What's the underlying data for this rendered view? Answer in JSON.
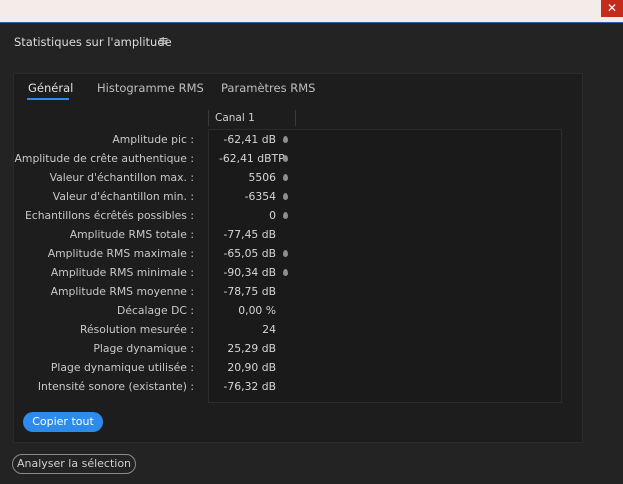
{
  "window": {
    "close_glyph": "✕"
  },
  "panel": {
    "title": "Statistiques sur l'amplitude",
    "menu_icon": "menu-icon"
  },
  "tabs": [
    {
      "label": "Général",
      "active": true
    },
    {
      "label": "Histogramme RMS",
      "active": false
    },
    {
      "label": "Paramètres RMS",
      "active": false
    }
  ],
  "table": {
    "column_header": "Canal 1",
    "rows": [
      {
        "label": "Amplitude pic :",
        "value": "-62,41 dB",
        "pin": true
      },
      {
        "label": "Amplitude de crête authentique :",
        "value": "-62,41 dBTP",
        "pin": true
      },
      {
        "label": "Valeur d'échantillon max. :",
        "value": "5506",
        "pin": true
      },
      {
        "label": "Valeur d'échantillon min. :",
        "value": "-6354",
        "pin": true
      },
      {
        "label": "Echantillons écrêtés possibles :",
        "value": "0",
        "pin": true
      },
      {
        "label": "Amplitude RMS totale :",
        "value": "-77,45 dB",
        "pin": false
      },
      {
        "label": "Amplitude RMS maximale :",
        "value": "-65,05 dB",
        "pin": true
      },
      {
        "label": "Amplitude RMS minimale :",
        "value": "-90,34 dB",
        "pin": true
      },
      {
        "label": "Amplitude RMS moyenne :",
        "value": "-78,75 dB",
        "pin": false
      },
      {
        "label": "Décalage DC :",
        "value": "0,00 %",
        "pin": false
      },
      {
        "label": "Résolution mesurée :",
        "value": "24",
        "pin": false
      },
      {
        "label": "Plage dynamique :",
        "value": "25,29 dB",
        "pin": false
      },
      {
        "label": "Plage dynamique utilisée :",
        "value": "20,90 dB",
        "pin": false
      },
      {
        "label": "Intensité sonore (existante) :",
        "value": "-76,32 dB",
        "pin": false
      }
    ]
  },
  "buttons": {
    "copy_all": "Copier tout",
    "analyze_selection": "Analyser la sélection"
  },
  "colors": {
    "accent": "#2d8ceb",
    "close": "#c42b1c",
    "background": "#232323"
  }
}
